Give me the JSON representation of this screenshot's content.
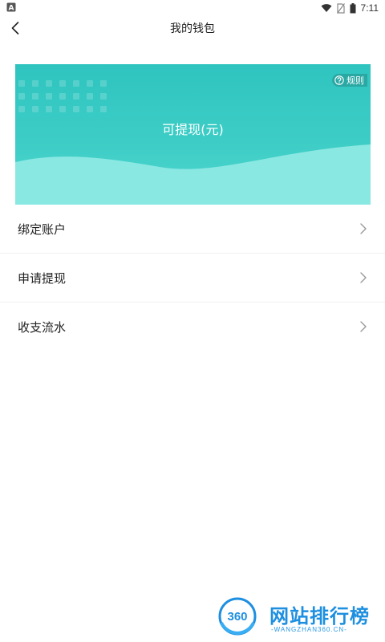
{
  "status_bar": {
    "time": "7:11",
    "icons": [
      "notification-a-icon",
      "wifi-icon",
      "no-sim-icon",
      "battery-icon"
    ]
  },
  "header": {
    "title": "我的钱包",
    "back_icon": "chevron-left-icon"
  },
  "wallet_card": {
    "label": "可提现(元)",
    "rules_label": "规则",
    "rules_icon": "question-circle-icon",
    "colors": {
      "top": "#2fc4bf",
      "bottom": "#4fd7cf",
      "wave": "#8ae8e2"
    }
  },
  "menu": {
    "items": [
      {
        "label": "绑定账户",
        "icon": "chevron-right-icon"
      },
      {
        "label": "申请提现",
        "icon": "chevron-right-icon"
      },
      {
        "label": "收支流水",
        "icon": "chevron-right-icon"
      }
    ]
  },
  "watermark": {
    "logo_text": "360",
    "title": "网站排行榜",
    "subtitle": "-WANGZHAN360.CN-"
  }
}
